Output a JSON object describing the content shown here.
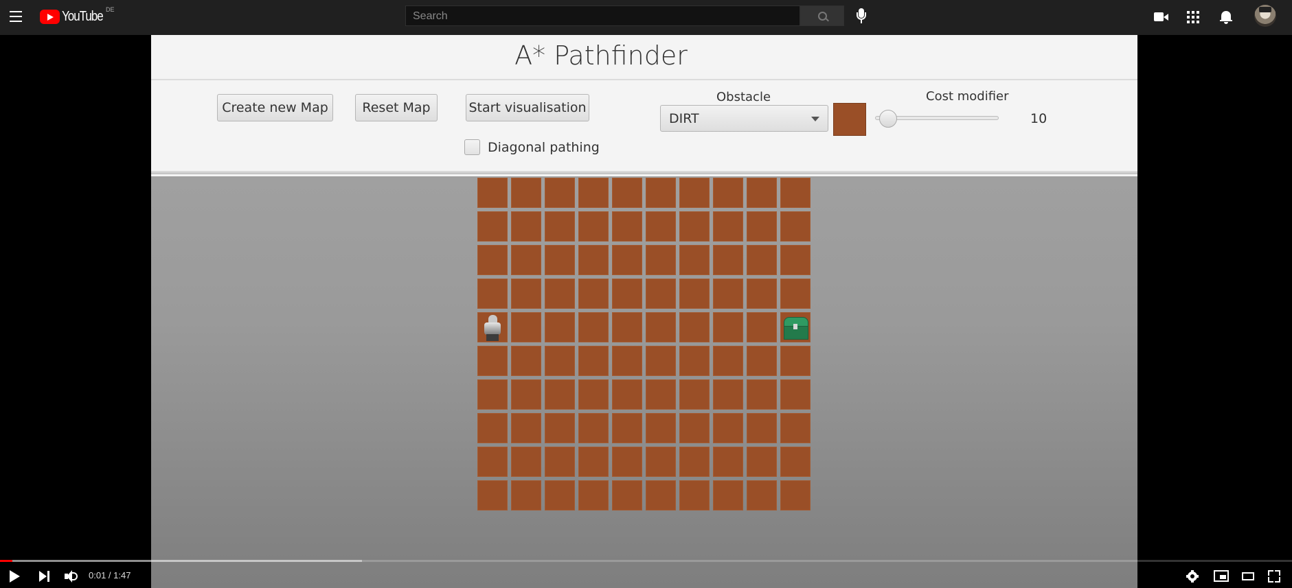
{
  "youtube": {
    "logo_text": "YouTube",
    "country_code": "DE",
    "search_placeholder": "Search",
    "icons": [
      "menu-icon",
      "search-icon",
      "mic-icon",
      "create-video-icon",
      "apps-icon",
      "notifications-icon",
      "avatar"
    ]
  },
  "app": {
    "title": "A* Pathfinder",
    "buttons": {
      "create_map": "Create new Map",
      "reset_map": "Reset Map",
      "start_visualisation": "Start visualisation"
    },
    "diagonal_pathing": {
      "label": "Diagonal pathing",
      "checked": false
    },
    "obstacle": {
      "label": "Obstacle",
      "selected": "DIRT",
      "color": "#9a4f27"
    },
    "cost_modifier": {
      "label": "Cost modifier",
      "value": "10",
      "slider_fraction": 0.05
    },
    "grid": {
      "rows": 10,
      "cols": 10,
      "cell_color": "#9a4f27",
      "start": {
        "row": 4,
        "col": 0,
        "icon": "knight-icon"
      },
      "goal": {
        "row": 4,
        "col": 9,
        "icon": "treasure-chest-icon"
      }
    }
  },
  "player": {
    "time": "0:01 / 1:47",
    "played_fraction": 0.0095,
    "loaded_fraction": 0.28,
    "progress_color": "#ff0000",
    "icons": [
      "play-icon",
      "next-icon",
      "volume-icon",
      "settings-icon",
      "miniplayer-icon",
      "theater-icon",
      "fullscreen-icon"
    ]
  }
}
